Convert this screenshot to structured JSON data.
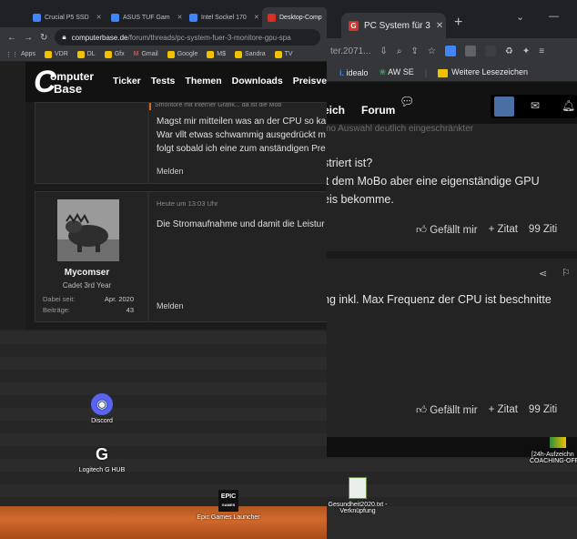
{
  "left_browser": {
    "tabs": [
      {
        "title": "Crucial P5 SSD",
        "favicon_color": "#4285f4"
      },
      {
        "title": "ASUS TUF Gam",
        "favicon_color": "#4285f4"
      },
      {
        "title": "Intel Sockel 170",
        "favicon_color": "#4285f4"
      },
      {
        "title": "Desktop-Comp",
        "favicon_color": "#d93025"
      }
    ],
    "url_host": "computerbase.de",
    "url_path": "/forum/threads/pc-system-fuer-3-monitore-gpu-spa",
    "bookmarks": [
      "Apps",
      "VDR",
      "DL",
      "Gfx",
      "Gmail",
      "Google",
      "M$",
      "Sandra",
      "TV"
    ],
    "site": {
      "logo_top": "omputer",
      "logo_bottom": "Base",
      "logo_c": "C",
      "nav": [
        "Ticker",
        "Tests",
        "Themen",
        "Downloads",
        "Preisvergle"
      ]
    },
    "post1": {
      "quote_fragment": "Smontore mit interner Grafik... da ist die Mob",
      "lines": [
        "Magst mir mitteilen was an der CPU so ka",
        "War vllt etwas schwammig ausgedrückt m",
        "folgt sobald ich eine zum anständigen Pre"
      ],
      "report_label": "Melden"
    },
    "post2": {
      "time": "Heute um 13:03 Uhr",
      "text": "Die Stromaufnahme und damit die Leistur",
      "report_label": "Melden",
      "user": {
        "name": "Mycomser",
        "title": "Cadet 3rd Year",
        "joined_label": "Dabei seit:",
        "joined_value": "Apr. 2020",
        "posts_label": "Beiträge:",
        "posts_value": "43"
      }
    }
  },
  "right_browser": {
    "tab_title": "PC System für 3",
    "tab_favicon": "G",
    "url_fragment": "ter.2071...",
    "bookmarks": [
      "idealo",
      "AW SE",
      "Weitere Lesezeichen"
    ],
    "site_nav": [
      "eich",
      "Forum"
    ],
    "post1": {
      "faded_line": "mo Auswahl deutlich eingeschränkter",
      "lines": [
        "striert ist?",
        "it dem MoBo aber eine eigenständige GPU",
        "eis bekomme."
      ],
      "actions": [
        "Gefällt mir",
        "+ Zitat",
        "99 Ziti"
      ]
    },
    "post2": {
      "line": "ng inkl. Max Frequenz der CPU ist beschnitte",
      "actions": [
        "Gefällt mir",
        "+ Zitat",
        "99 Ziti"
      ]
    }
  },
  "desktop": {
    "icons": [
      {
        "label": "Discord"
      },
      {
        "label": "Logitech G HUB"
      },
      {
        "label": "Epic Games Launcher"
      },
      {
        "label": "Gesundheit2020.txt -"
      },
      {
        "label": "Verknüpfung"
      },
      {
        "label": "[24h-Aufzeichn"
      },
      {
        "label": "COACHING-OFF"
      }
    ],
    "epic_logo_text": "EPIC",
    "epic_logo_sub": "GAMES"
  },
  "colors": {
    "brand_orange": "#d86a1e",
    "discord_blurple": "#5865f2",
    "chrome_dark": "#202124",
    "chrome_toolbar": "#35363a"
  }
}
